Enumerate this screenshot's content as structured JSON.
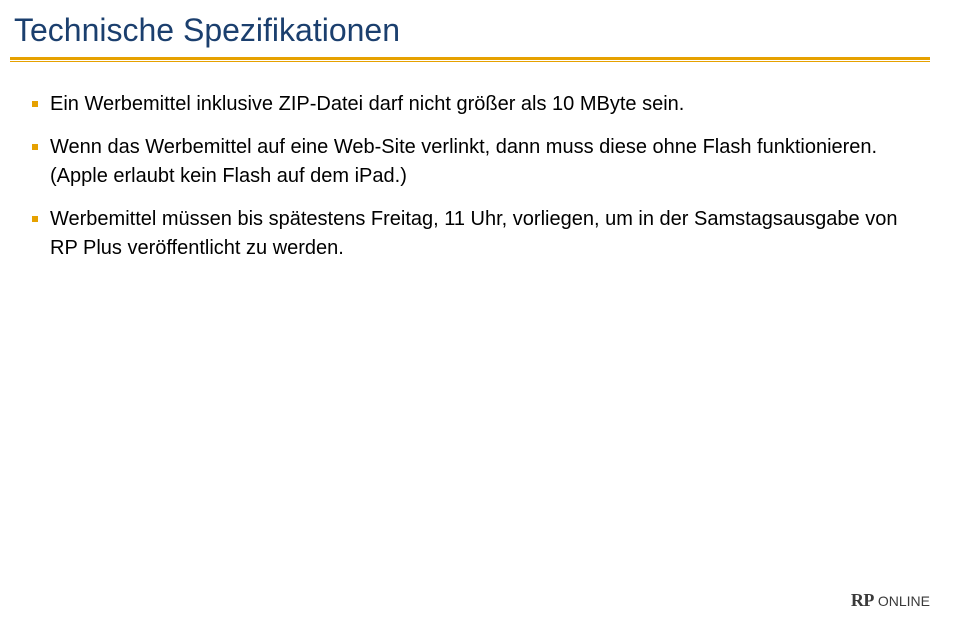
{
  "title": "Technische Spezifikationen",
  "bullets": [
    "Ein Werbemittel inklusive ZIP-Datei darf nicht größer als 10 MByte sein.",
    "Wenn das Werbemittel auf eine Web-Site verlinkt, dann muss diese ohne Flash funktionieren. (Apple erlaubt kein Flash auf dem iPad.)",
    "Werbemittel müssen bis spätestens Freitag, 11 Uhr, vorliegen, um in der Samstagsausgabe von RP Plus veröffentlicht zu werden."
  ],
  "logo": {
    "rp": "RP",
    "online": "ONLINE"
  }
}
